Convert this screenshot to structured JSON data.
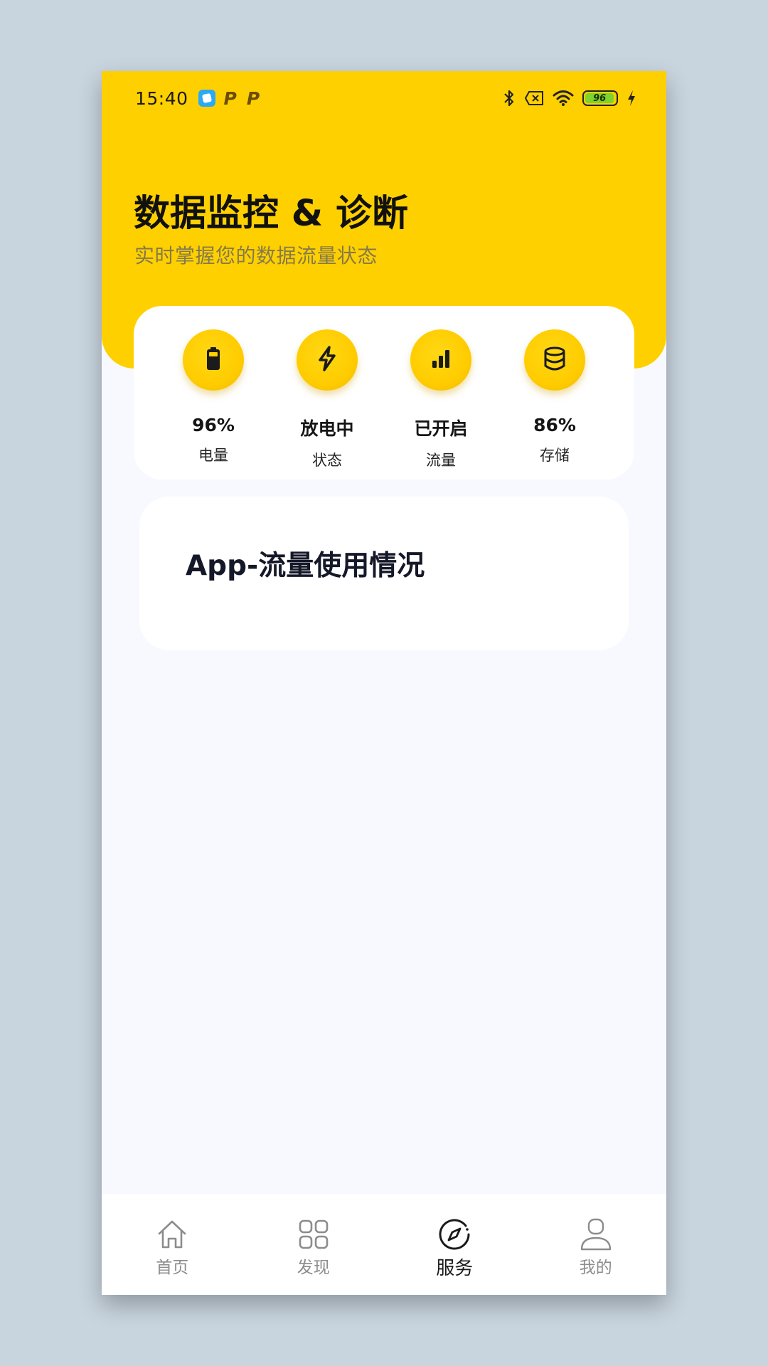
{
  "status_bar": {
    "time": "15:40",
    "p_badge_1": "P",
    "p_badge_2": "P",
    "battery_level": "96",
    "battery_fill_color": "#7cd42f"
  },
  "header": {
    "title": "数据监控 & 诊断",
    "subtitle": "实时掌握您的数据流量状态",
    "background_color": "#ffd000"
  },
  "stats": [
    {
      "icon": "battery-icon",
      "value": "96%",
      "label": "电量"
    },
    {
      "icon": "lightning-icon",
      "value": "放电中",
      "label": "状态"
    },
    {
      "icon": "signal-bars-icon",
      "value": "已开启",
      "label": "流量"
    },
    {
      "icon": "database-icon",
      "value": "86%",
      "label": "存储"
    }
  ],
  "app_usage_card": {
    "title": "App-流量使用情况"
  },
  "tab_bar": {
    "active_tab": "服务",
    "tabs": [
      {
        "icon": "home-icon",
        "label": "首页"
      },
      {
        "icon": "grid-icon",
        "label": "发现"
      },
      {
        "icon": "compass-icon",
        "label": "服务"
      },
      {
        "icon": "user-icon",
        "label": "我的"
      }
    ]
  }
}
